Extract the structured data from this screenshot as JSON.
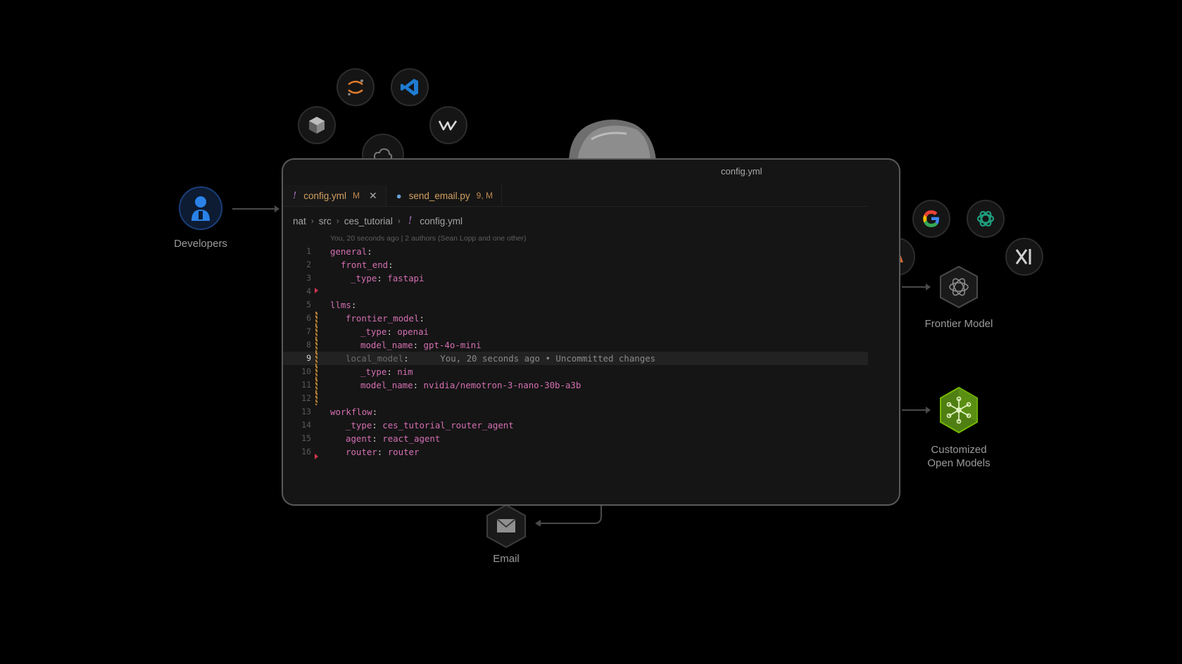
{
  "colors": {
    "accent_pink": "#d46fb2",
    "tab_orange": "#d09f60",
    "nvidia_green": "#76b900",
    "developer_blue": "#1e6fd0"
  },
  "diagram": {
    "developers_label": "Developers",
    "frontier_label": "Frontier Model",
    "customized_label_line1": "Customized",
    "customized_label_line2": "Open Models",
    "email_label": "Email",
    "tool_icons": [
      "jupyter-icon",
      "vscode-icon",
      "cube-tool-icon",
      "windsurf-icon",
      "cloud-icon"
    ],
    "provider_icons": [
      "google-icon",
      "openai-icon",
      "xai-icon",
      "anthropic-icon"
    ]
  },
  "editor": {
    "window_title": "config.yml",
    "tabs": [
      {
        "name": "config.yml",
        "status": "M",
        "close": "✕"
      },
      {
        "name": "send_email.py",
        "status": "9, M"
      }
    ],
    "breadcrumb": [
      "nat",
      "src",
      "ces_tutorial",
      "config.yml"
    ],
    "blame_header": "You, 20 seconds ago | 2 authors (Sean Lopp and one other)",
    "current_line": "9",
    "inline_blame": "You, 20 seconds ago • Uncommitted changes",
    "lines": [
      {
        "n": "1",
        "key": "general",
        "value": ""
      },
      {
        "n": "2",
        "key": "front_end",
        "value": ""
      },
      {
        "n": "3",
        "key": "_type",
        "value": "fastapi"
      },
      {
        "n": "4",
        "key": "",
        "value": ""
      },
      {
        "n": "5",
        "key": "llms",
        "value": ""
      },
      {
        "n": "6",
        "key": "frontier_model",
        "value": ""
      },
      {
        "n": "7",
        "key": "_type",
        "value": "openai"
      },
      {
        "n": "8",
        "key": "model_name",
        "value": "gpt-4o-mini"
      },
      {
        "n": "9",
        "key": "local_model",
        "value": ""
      },
      {
        "n": "10",
        "key": "_type",
        "value": "nim"
      },
      {
        "n": "11",
        "key": "model_name",
        "value": "nvidia/nemotron-3-nano-30b-a3b"
      },
      {
        "n": "12",
        "key": "",
        "value": ""
      },
      {
        "n": "13",
        "key": "workflow",
        "value": ""
      },
      {
        "n": "14",
        "key": "_type",
        "value": "ces_tutorial_router_agent"
      },
      {
        "n": "15",
        "key": "agent",
        "value": "react_agent"
      },
      {
        "n": "16",
        "key": "router",
        "value": "router"
      }
    ]
  }
}
